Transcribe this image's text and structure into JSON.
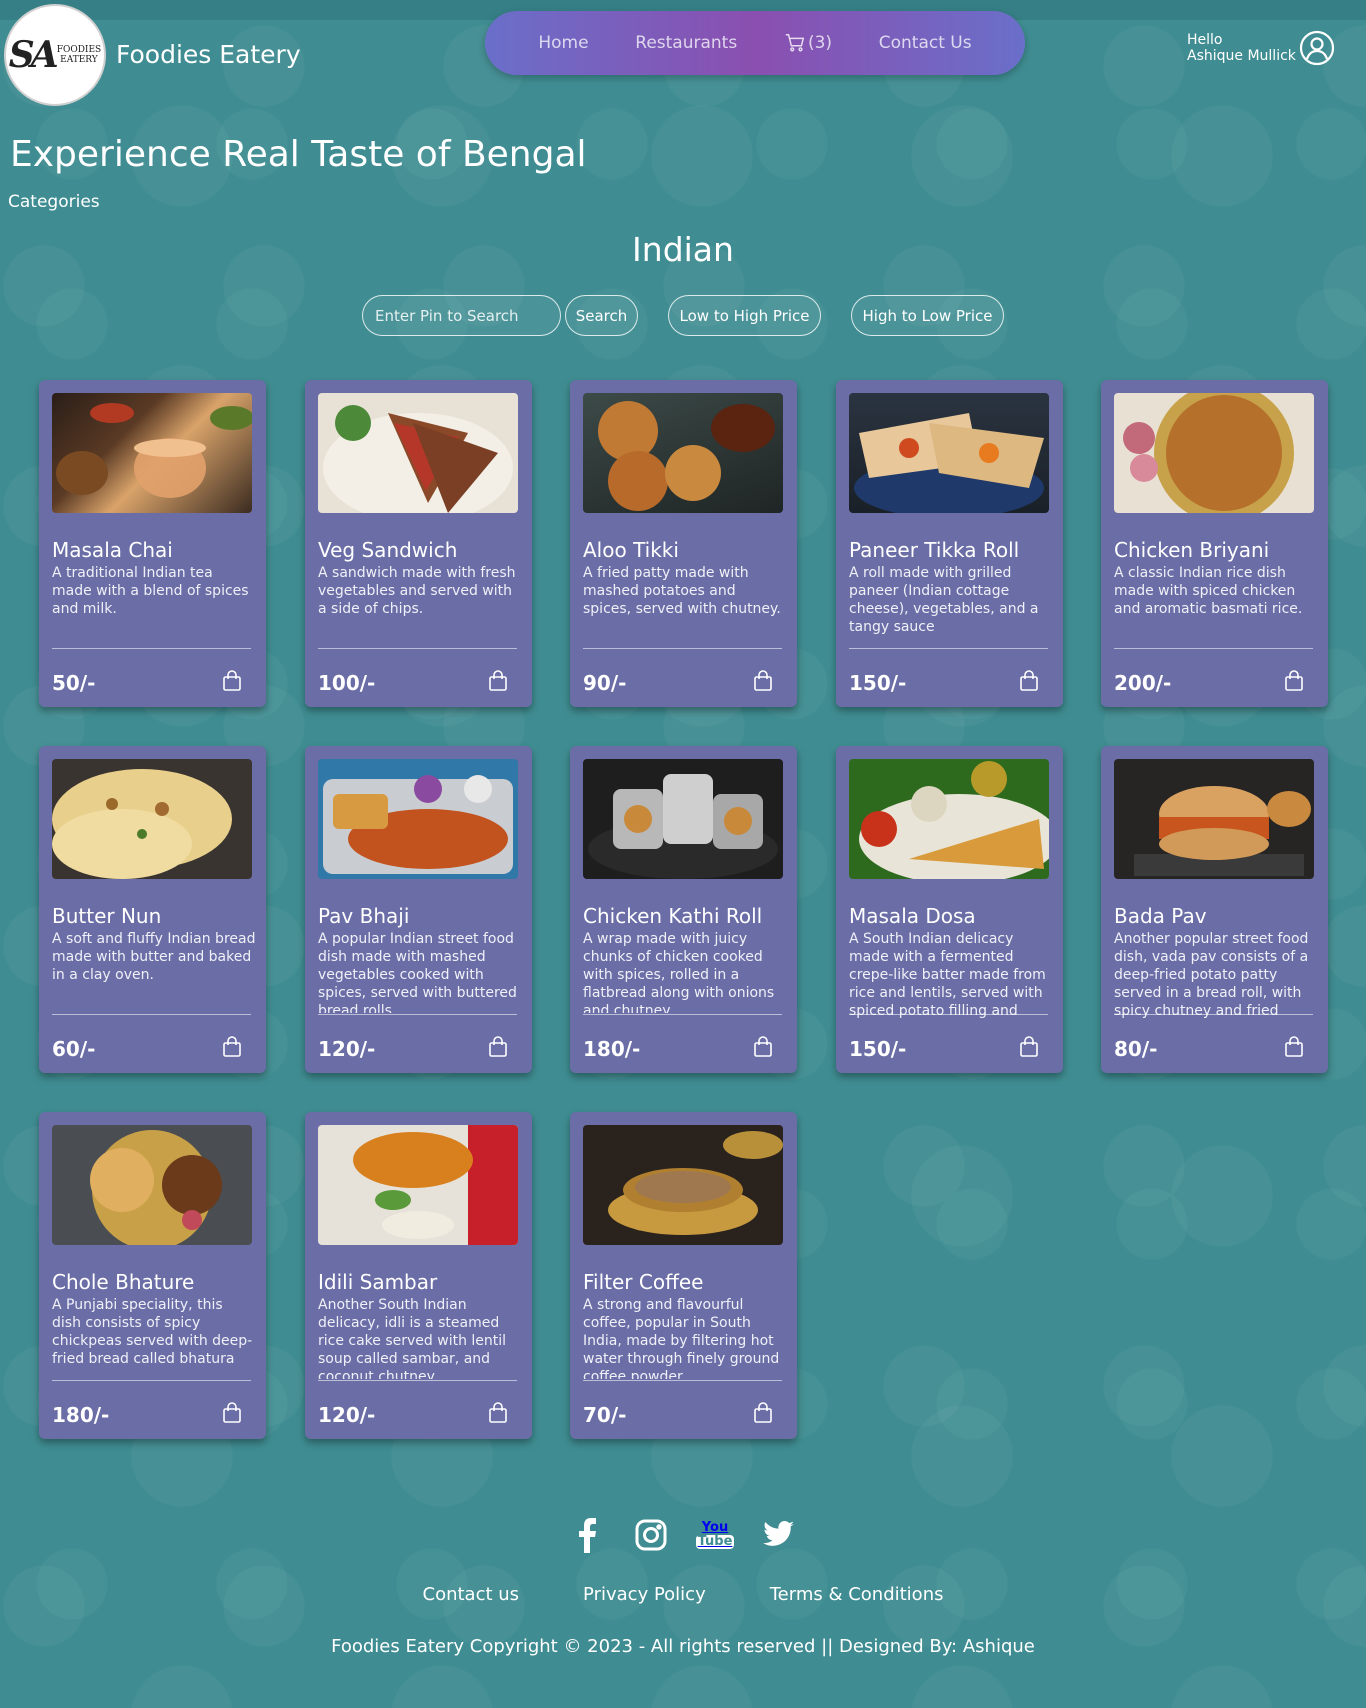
{
  "brand": {
    "logo_initials": "SA",
    "logo_line1": "FOODIES",
    "logo_line2": "EATERY",
    "name": "Foodies Eatery"
  },
  "nav": {
    "home": "Home",
    "restaurants": "Restaurants",
    "cart_count": "(3)",
    "contact": "Contact Us"
  },
  "user": {
    "greeting": "Hello",
    "name": "Ashique Mullick"
  },
  "hero": {
    "title": "Experience Real Taste of Bengal",
    "categories": "Categories",
    "category_title": "Indian"
  },
  "search": {
    "placeholder": "Enter Pin to Search",
    "search_label": "Search",
    "low_high": "Low to High Price",
    "high_low": "High to Low Price"
  },
  "items": [
    {
      "name": "Masala Chai",
      "desc": "A traditional Indian tea made with a blend of spices and milk.",
      "price": "50/-"
    },
    {
      "name": "Veg Sandwich",
      "desc": "A sandwich made with fresh vegetables and served with a side of chips.",
      "price": "100/-"
    },
    {
      "name": "Aloo Tikki",
      "desc": "A fried patty made with mashed potatoes and spices, served with chutney.",
      "price": "90/-"
    },
    {
      "name": "Paneer Tikka Roll",
      "desc": "A roll made with grilled paneer (Indian cottage cheese), vegetables, and a tangy sauce",
      "price": "150/-"
    },
    {
      "name": "Chicken Briyani",
      "desc": "A classic Indian rice dish made with spiced chicken and aromatic basmati rice.",
      "price": "200/-"
    },
    {
      "name": "Butter Nun",
      "desc": "A soft and fluffy Indian bread made with butter and baked in a clay oven.",
      "price": "60/-"
    },
    {
      "name": "Pav Bhaji",
      "desc": "A popular Indian street food dish made with mashed vegetables cooked with spices, served with buttered bread rolls.",
      "price": "120/-"
    },
    {
      "name": "Chicken Kathi Roll",
      "desc": "A wrap made with juicy chunks of chicken cooked with spices, rolled in a flatbread along with onions and chutney",
      "price": "180/-"
    },
    {
      "name": "Masala Dosa",
      "desc": "A South Indian delicacy made with a fermented crepe-like batter made from rice and lentils, served with spiced potato filling and coconut chutney.",
      "price": "150/-"
    },
    {
      "name": "Bada Pav",
      "desc": "Another popular street food dish, vada pav consists of a deep-fried potato patty served in a bread roll, with spicy chutney and fried green chillies",
      "price": "80/-"
    },
    {
      "name": "Chole Bhature",
      "desc": "A Punjabi speciality, this dish consists of spicy chickpeas served with deep-fried bread called bhatura",
      "price": "180/-"
    },
    {
      "name": "Idili Sambar",
      "desc": "Another South Indian delicacy, idli is a steamed rice cake served with lentil soup called sambar, and coconut chutney",
      "price": "120/-"
    },
    {
      "name": "Filter Coffee",
      "desc": "A strong and flavourful coffee, popular in South India, made by filtering hot water through finely ground coffee powder",
      "price": "70/-"
    }
  ],
  "socials": {
    "youtube_top": "You",
    "youtube_bottom": "Tube"
  },
  "footer": {
    "contact": "Contact us",
    "privacy": "Privacy Policy",
    "terms": "Terms & Conditions",
    "copyright": "Foodies Eatery Copyright © 2023 - All rights reserved || Designed By: Ashique"
  }
}
